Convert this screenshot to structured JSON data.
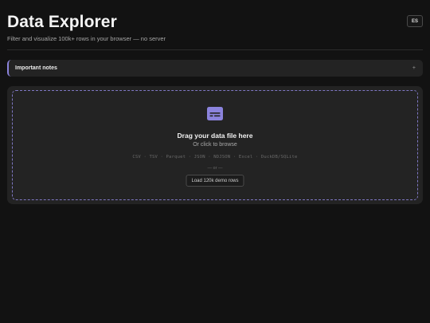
{
  "header": {
    "title": "Data Explorer",
    "subtitle": "Filter and visualize 100k+ rows in your browser — no server",
    "lang_button": "ES"
  },
  "notes": {
    "label": "Important notes",
    "toggle": "+"
  },
  "dropzone": {
    "icon": "file-icon",
    "title": "Drag your data file here",
    "subtitle": "Or click to browse",
    "formats": "CSV · TSV · Parquet · JSON · NDJSON · Excel · DuckDB/SQLite",
    "or_text": "— or —",
    "demo_button": "Load 120k demo rows"
  },
  "colors": {
    "background": "#121212",
    "card": "#232323",
    "accent": "#8b83dd"
  }
}
